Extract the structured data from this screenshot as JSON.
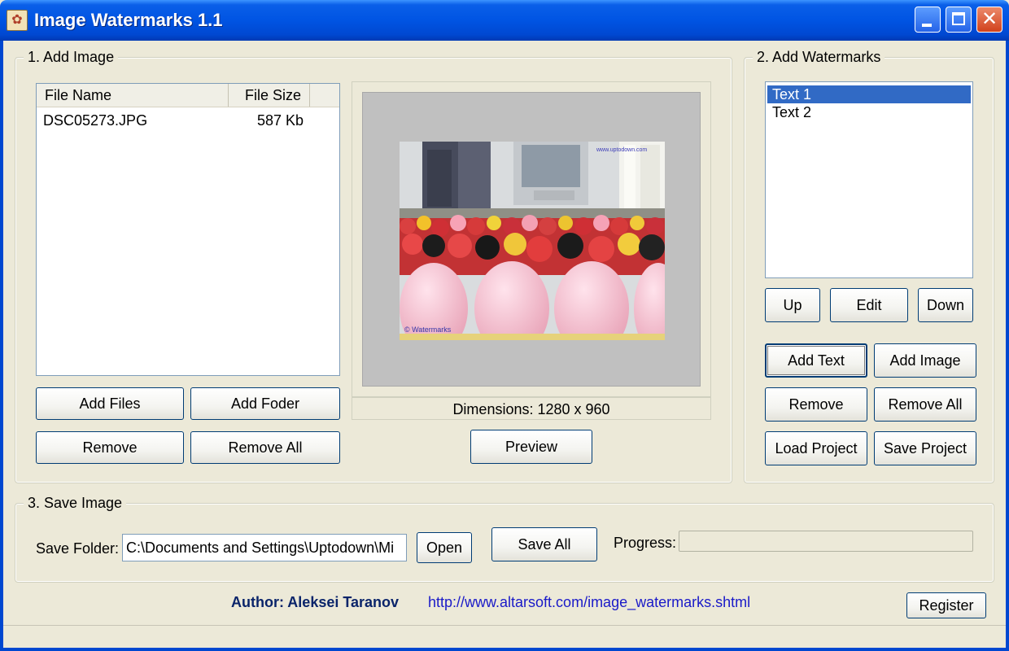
{
  "window": {
    "title": "Image Watermarks 1.1",
    "icon": "palette-app-icon",
    "controls": [
      "minimize-icon",
      "maximize-icon",
      "close-icon"
    ]
  },
  "add_image": {
    "title": "1. Add Image",
    "columns": [
      "File Name",
      "File Size"
    ],
    "files": [
      {
        "name": "DSC05273.JPG",
        "size": "587 Kb"
      }
    ],
    "buttons": {
      "add_files": "Add Files",
      "add_folder": "Add Foder",
      "remove": "Remove",
      "remove_all": "Remove All",
      "preview": "Preview"
    },
    "dimensions": "Dimensions: 1280 x 960"
  },
  "watermarks": {
    "title": "2. Add Watermarks",
    "items": [
      {
        "label": "Text 1",
        "selected": true
      },
      {
        "label": "Text 2",
        "selected": false
      }
    ],
    "buttons": {
      "up": "Up",
      "edit": "Edit",
      "down": "Down",
      "add_text": "Add Text",
      "add_image": "Add Image",
      "remove": "Remove",
      "remove_all": "Remove All",
      "load_project": "Load Project",
      "save_project": "Save Project"
    }
  },
  "save_image": {
    "title": "3. Save Image",
    "folder_label": "Save Folder:",
    "folder_value": "C:\\Documents and Settings\\Uptodown\\Mi",
    "open": "Open",
    "save_all": "Save All",
    "progress_label": "Progress:",
    "progress_value": 0
  },
  "footer": {
    "author": "Author: Aleksei Taranov",
    "url": "http://www.altarsoft.com/image_watermarks.shtml",
    "register": "Register"
  },
  "colors": {
    "title_bar": "#0054e3",
    "selection": "#316ac5",
    "author_text": "#0a246a",
    "link_text": "#1a1ac8"
  }
}
